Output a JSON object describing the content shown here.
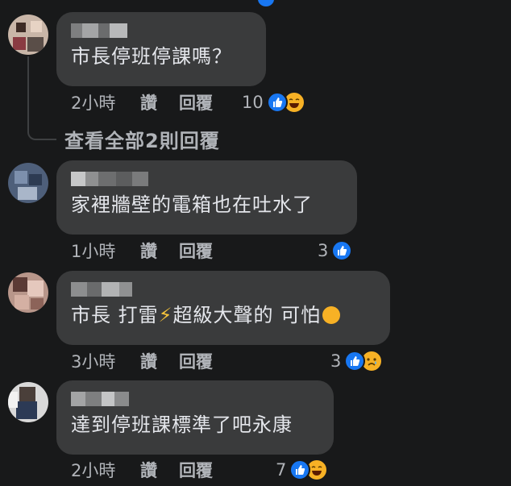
{
  "comments": [
    {
      "text": "市長停班停課嗎？",
      "time": "2小時",
      "like_label": "讚",
      "reply_label": "回覆",
      "reaction_count": "10",
      "reactions": [
        "like-icon",
        "laughing-emoji-icon"
      ]
    },
    {
      "text": "家裡牆壁的電箱也在吐水了",
      "time": "1小時",
      "like_label": "讚",
      "reply_label": "回覆",
      "reaction_count": "3",
      "reactions": [
        "like-icon"
      ]
    },
    {
      "text_before": "市長 打雷",
      "text_after": "超級大聲的 可怕",
      "time": "3小時",
      "like_label": "讚",
      "reply_label": "回覆",
      "reaction_count": "3",
      "reactions": [
        "like-icon",
        "sad-emoji-icon"
      ]
    },
    {
      "text": "達到停班課標準了吧永康",
      "time": "2小時",
      "like_label": "讚",
      "reply_label": "回覆",
      "reaction_count": "7",
      "reactions": [
        "like-icon",
        "laughing-emoji-icon"
      ]
    }
  ],
  "view_replies_label": "查看全部2則回覆",
  "colors": {
    "background": "#18191a",
    "bubble": "#3a3b3c",
    "text": "#e4e6eb",
    "secondary_text": "#b0b3b8",
    "like_blue": "#1877f2",
    "emoji_yellow": "#f7b125"
  }
}
